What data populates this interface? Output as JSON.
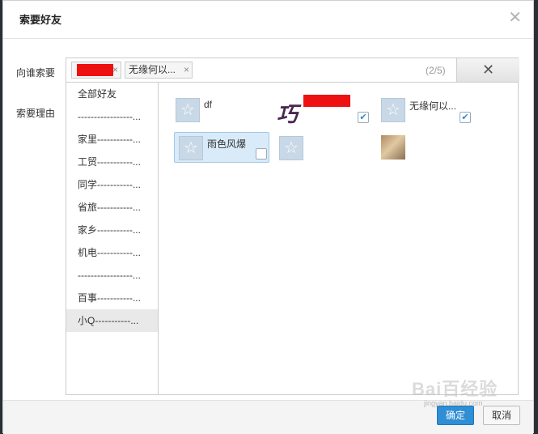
{
  "dialog": {
    "title": "索要好友",
    "close_glyph": "✕"
  },
  "form": {
    "to_label": "向谁索要",
    "reason_label": "索要理由"
  },
  "recipients": {
    "tags": [
      {
        "name": "",
        "remove": "×"
      },
      {
        "name": "无缘何以...",
        "remove": "×"
      }
    ],
    "count": "(2/5)",
    "clear_glyph": "✕"
  },
  "groups": [
    {
      "label": "全部好友"
    },
    {
      "label": "-----------------..."
    },
    {
      "label": "家里-----------..."
    },
    {
      "label": "工贸-----------..."
    },
    {
      "label": "同学-----------..."
    },
    {
      "label": "省旅-----------..."
    },
    {
      "label": "家乡-----------..."
    },
    {
      "label": "机电-----------..."
    },
    {
      "label": "-----------------..."
    },
    {
      "label": "百事-----------..."
    },
    {
      "label": "小Q-----------..."
    }
  ],
  "friends": [
    {
      "name": "df",
      "checked": false
    },
    {
      "name": "",
      "checked": true
    },
    {
      "name": "无缘何以...",
      "checked": true
    },
    {
      "name": "雨色风爆",
      "checked": false
    },
    {
      "name": "",
      "checked": false
    },
    {
      "name": "",
      "checked": false
    }
  ],
  "footer": {
    "ok_label": "确定",
    "cancel_label": "取消"
  },
  "watermark": {
    "text": "Bai百经验",
    "sub": "jingyan.baidu.com"
  },
  "icons": {
    "avatar_default": "star-avatar-icon",
    "check": "checkmark-icon"
  },
  "colors": {
    "accent": "#2f8ed4",
    "selected_bg": "#d9ebf9",
    "redaction": "#ee1111"
  }
}
